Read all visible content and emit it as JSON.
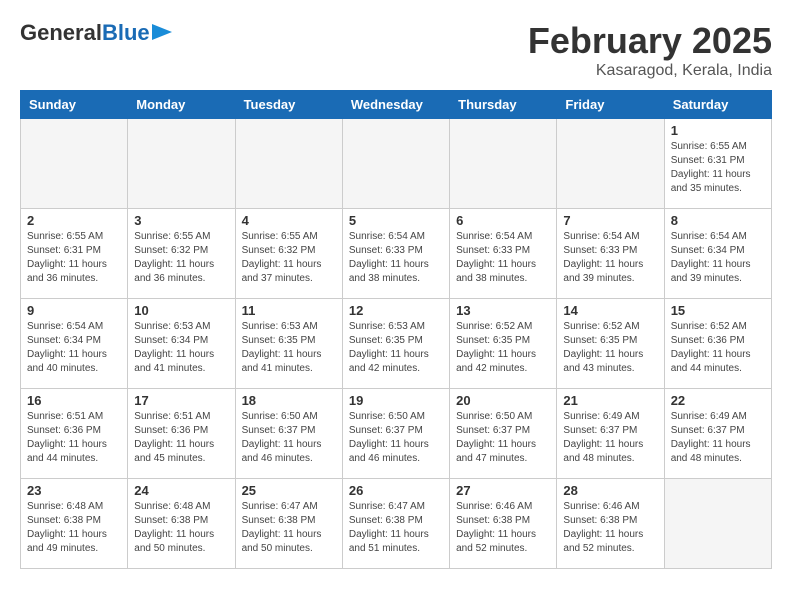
{
  "header": {
    "logo_general": "General",
    "logo_blue": "Blue",
    "month": "February 2025",
    "location": "Kasaragod, Kerala, India"
  },
  "days_of_week": [
    "Sunday",
    "Monday",
    "Tuesday",
    "Wednesday",
    "Thursday",
    "Friday",
    "Saturday"
  ],
  "weeks": [
    [
      {
        "day": "",
        "info": ""
      },
      {
        "day": "",
        "info": ""
      },
      {
        "day": "",
        "info": ""
      },
      {
        "day": "",
        "info": ""
      },
      {
        "day": "",
        "info": ""
      },
      {
        "day": "",
        "info": ""
      },
      {
        "day": "1",
        "info": "Sunrise: 6:55 AM\nSunset: 6:31 PM\nDaylight: 11 hours\nand 35 minutes."
      }
    ],
    [
      {
        "day": "2",
        "info": "Sunrise: 6:55 AM\nSunset: 6:31 PM\nDaylight: 11 hours\nand 36 minutes."
      },
      {
        "day": "3",
        "info": "Sunrise: 6:55 AM\nSunset: 6:32 PM\nDaylight: 11 hours\nand 36 minutes."
      },
      {
        "day": "4",
        "info": "Sunrise: 6:55 AM\nSunset: 6:32 PM\nDaylight: 11 hours\nand 37 minutes."
      },
      {
        "day": "5",
        "info": "Sunrise: 6:54 AM\nSunset: 6:33 PM\nDaylight: 11 hours\nand 38 minutes."
      },
      {
        "day": "6",
        "info": "Sunrise: 6:54 AM\nSunset: 6:33 PM\nDaylight: 11 hours\nand 38 minutes."
      },
      {
        "day": "7",
        "info": "Sunrise: 6:54 AM\nSunset: 6:33 PM\nDaylight: 11 hours\nand 39 minutes."
      },
      {
        "day": "8",
        "info": "Sunrise: 6:54 AM\nSunset: 6:34 PM\nDaylight: 11 hours\nand 39 minutes."
      }
    ],
    [
      {
        "day": "9",
        "info": "Sunrise: 6:54 AM\nSunset: 6:34 PM\nDaylight: 11 hours\nand 40 minutes."
      },
      {
        "day": "10",
        "info": "Sunrise: 6:53 AM\nSunset: 6:34 PM\nDaylight: 11 hours\nand 41 minutes."
      },
      {
        "day": "11",
        "info": "Sunrise: 6:53 AM\nSunset: 6:35 PM\nDaylight: 11 hours\nand 41 minutes."
      },
      {
        "day": "12",
        "info": "Sunrise: 6:53 AM\nSunset: 6:35 PM\nDaylight: 11 hours\nand 42 minutes."
      },
      {
        "day": "13",
        "info": "Sunrise: 6:52 AM\nSunset: 6:35 PM\nDaylight: 11 hours\nand 42 minutes."
      },
      {
        "day": "14",
        "info": "Sunrise: 6:52 AM\nSunset: 6:35 PM\nDaylight: 11 hours\nand 43 minutes."
      },
      {
        "day": "15",
        "info": "Sunrise: 6:52 AM\nSunset: 6:36 PM\nDaylight: 11 hours\nand 44 minutes."
      }
    ],
    [
      {
        "day": "16",
        "info": "Sunrise: 6:51 AM\nSunset: 6:36 PM\nDaylight: 11 hours\nand 44 minutes."
      },
      {
        "day": "17",
        "info": "Sunrise: 6:51 AM\nSunset: 6:36 PM\nDaylight: 11 hours\nand 45 minutes."
      },
      {
        "day": "18",
        "info": "Sunrise: 6:50 AM\nSunset: 6:37 PM\nDaylight: 11 hours\nand 46 minutes."
      },
      {
        "day": "19",
        "info": "Sunrise: 6:50 AM\nSunset: 6:37 PM\nDaylight: 11 hours\nand 46 minutes."
      },
      {
        "day": "20",
        "info": "Sunrise: 6:50 AM\nSunset: 6:37 PM\nDaylight: 11 hours\nand 47 minutes."
      },
      {
        "day": "21",
        "info": "Sunrise: 6:49 AM\nSunset: 6:37 PM\nDaylight: 11 hours\nand 48 minutes."
      },
      {
        "day": "22",
        "info": "Sunrise: 6:49 AM\nSunset: 6:37 PM\nDaylight: 11 hours\nand 48 minutes."
      }
    ],
    [
      {
        "day": "23",
        "info": "Sunrise: 6:48 AM\nSunset: 6:38 PM\nDaylight: 11 hours\nand 49 minutes."
      },
      {
        "day": "24",
        "info": "Sunrise: 6:48 AM\nSunset: 6:38 PM\nDaylight: 11 hours\nand 50 minutes."
      },
      {
        "day": "25",
        "info": "Sunrise: 6:47 AM\nSunset: 6:38 PM\nDaylight: 11 hours\nand 50 minutes."
      },
      {
        "day": "26",
        "info": "Sunrise: 6:47 AM\nSunset: 6:38 PM\nDaylight: 11 hours\nand 51 minutes."
      },
      {
        "day": "27",
        "info": "Sunrise: 6:46 AM\nSunset: 6:38 PM\nDaylight: 11 hours\nand 52 minutes."
      },
      {
        "day": "28",
        "info": "Sunrise: 6:46 AM\nSunset: 6:38 PM\nDaylight: 11 hours\nand 52 minutes."
      },
      {
        "day": "",
        "info": ""
      }
    ]
  ]
}
